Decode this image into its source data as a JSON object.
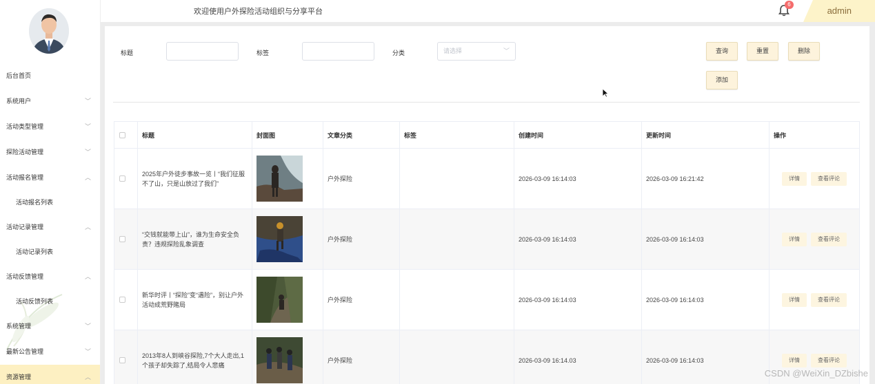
{
  "header": {
    "welcome": "欢迎使用户外探险活动组织与分享平台",
    "notification_count": "6",
    "username": "admin"
  },
  "sidebar": {
    "items": [
      {
        "label": "后台首页"
      },
      {
        "label": "系统用户"
      },
      {
        "label": "活动类型管理"
      },
      {
        "label": "探险活动管理"
      },
      {
        "label": "活动报名管理"
      },
      {
        "label": "活动报名列表"
      },
      {
        "label": "活动记录管理"
      },
      {
        "label": "活动记录列表"
      },
      {
        "label": "活动反馈管理"
      },
      {
        "label": "活动反馈列表"
      },
      {
        "label": "系统管理"
      },
      {
        "label": "最新公告管理"
      },
      {
        "label": "资源管理"
      }
    ]
  },
  "filters": {
    "title_label": "标题",
    "tag_label": "标签",
    "category_label": "分类",
    "category_placeholder": "请选择"
  },
  "buttons": {
    "search": "查询",
    "reset": "重置",
    "delete": "删除",
    "add": "添加"
  },
  "table": {
    "columns": [
      "标题",
      "封面图",
      "文章分类",
      "标签",
      "创建时间",
      "更新时间",
      "操作"
    ],
    "rows": [
      {
        "title": "2025年户外徒步事故一览丨“我们征服不了山，只是山放过了我们”",
        "category": "户外探险",
        "tag": "",
        "created": "2026-03-09 16:14:03",
        "updated": "2026-03-09 16:21:42"
      },
      {
        "title": "“交钱就能带上山”，谁为生命安全负责？违规探险乱象调查",
        "category": "户外探险",
        "tag": "",
        "created": "2026-03-09 16:14:03",
        "updated": "2026-03-09 16:14:03"
      },
      {
        "title": "新华时评丨“探险”变“遇险”，别让户外活动成荒野賭局",
        "category": "户外探险",
        "tag": "",
        "created": "2026-03-09 16:14:03",
        "updated": "2026-03-09 16:14:03"
      },
      {
        "title": "2013年8人到峡谷探险,7个大人走出,1个孩子却失踪了,结局令人悲痛",
        "category": "户外探险",
        "tag": "",
        "created": "2026-03-09 16:14.03",
        "updated": "2026-03-09 16:14:03"
      }
    ],
    "detail_label": "详情",
    "comments_label": "查看评论"
  },
  "watermark": "CSDN @WeiXin_DZbishe",
  "colors": {
    "accent": "#fdf3dc",
    "active_menu": "#fdf0c2",
    "badge": "#f56c6c"
  }
}
